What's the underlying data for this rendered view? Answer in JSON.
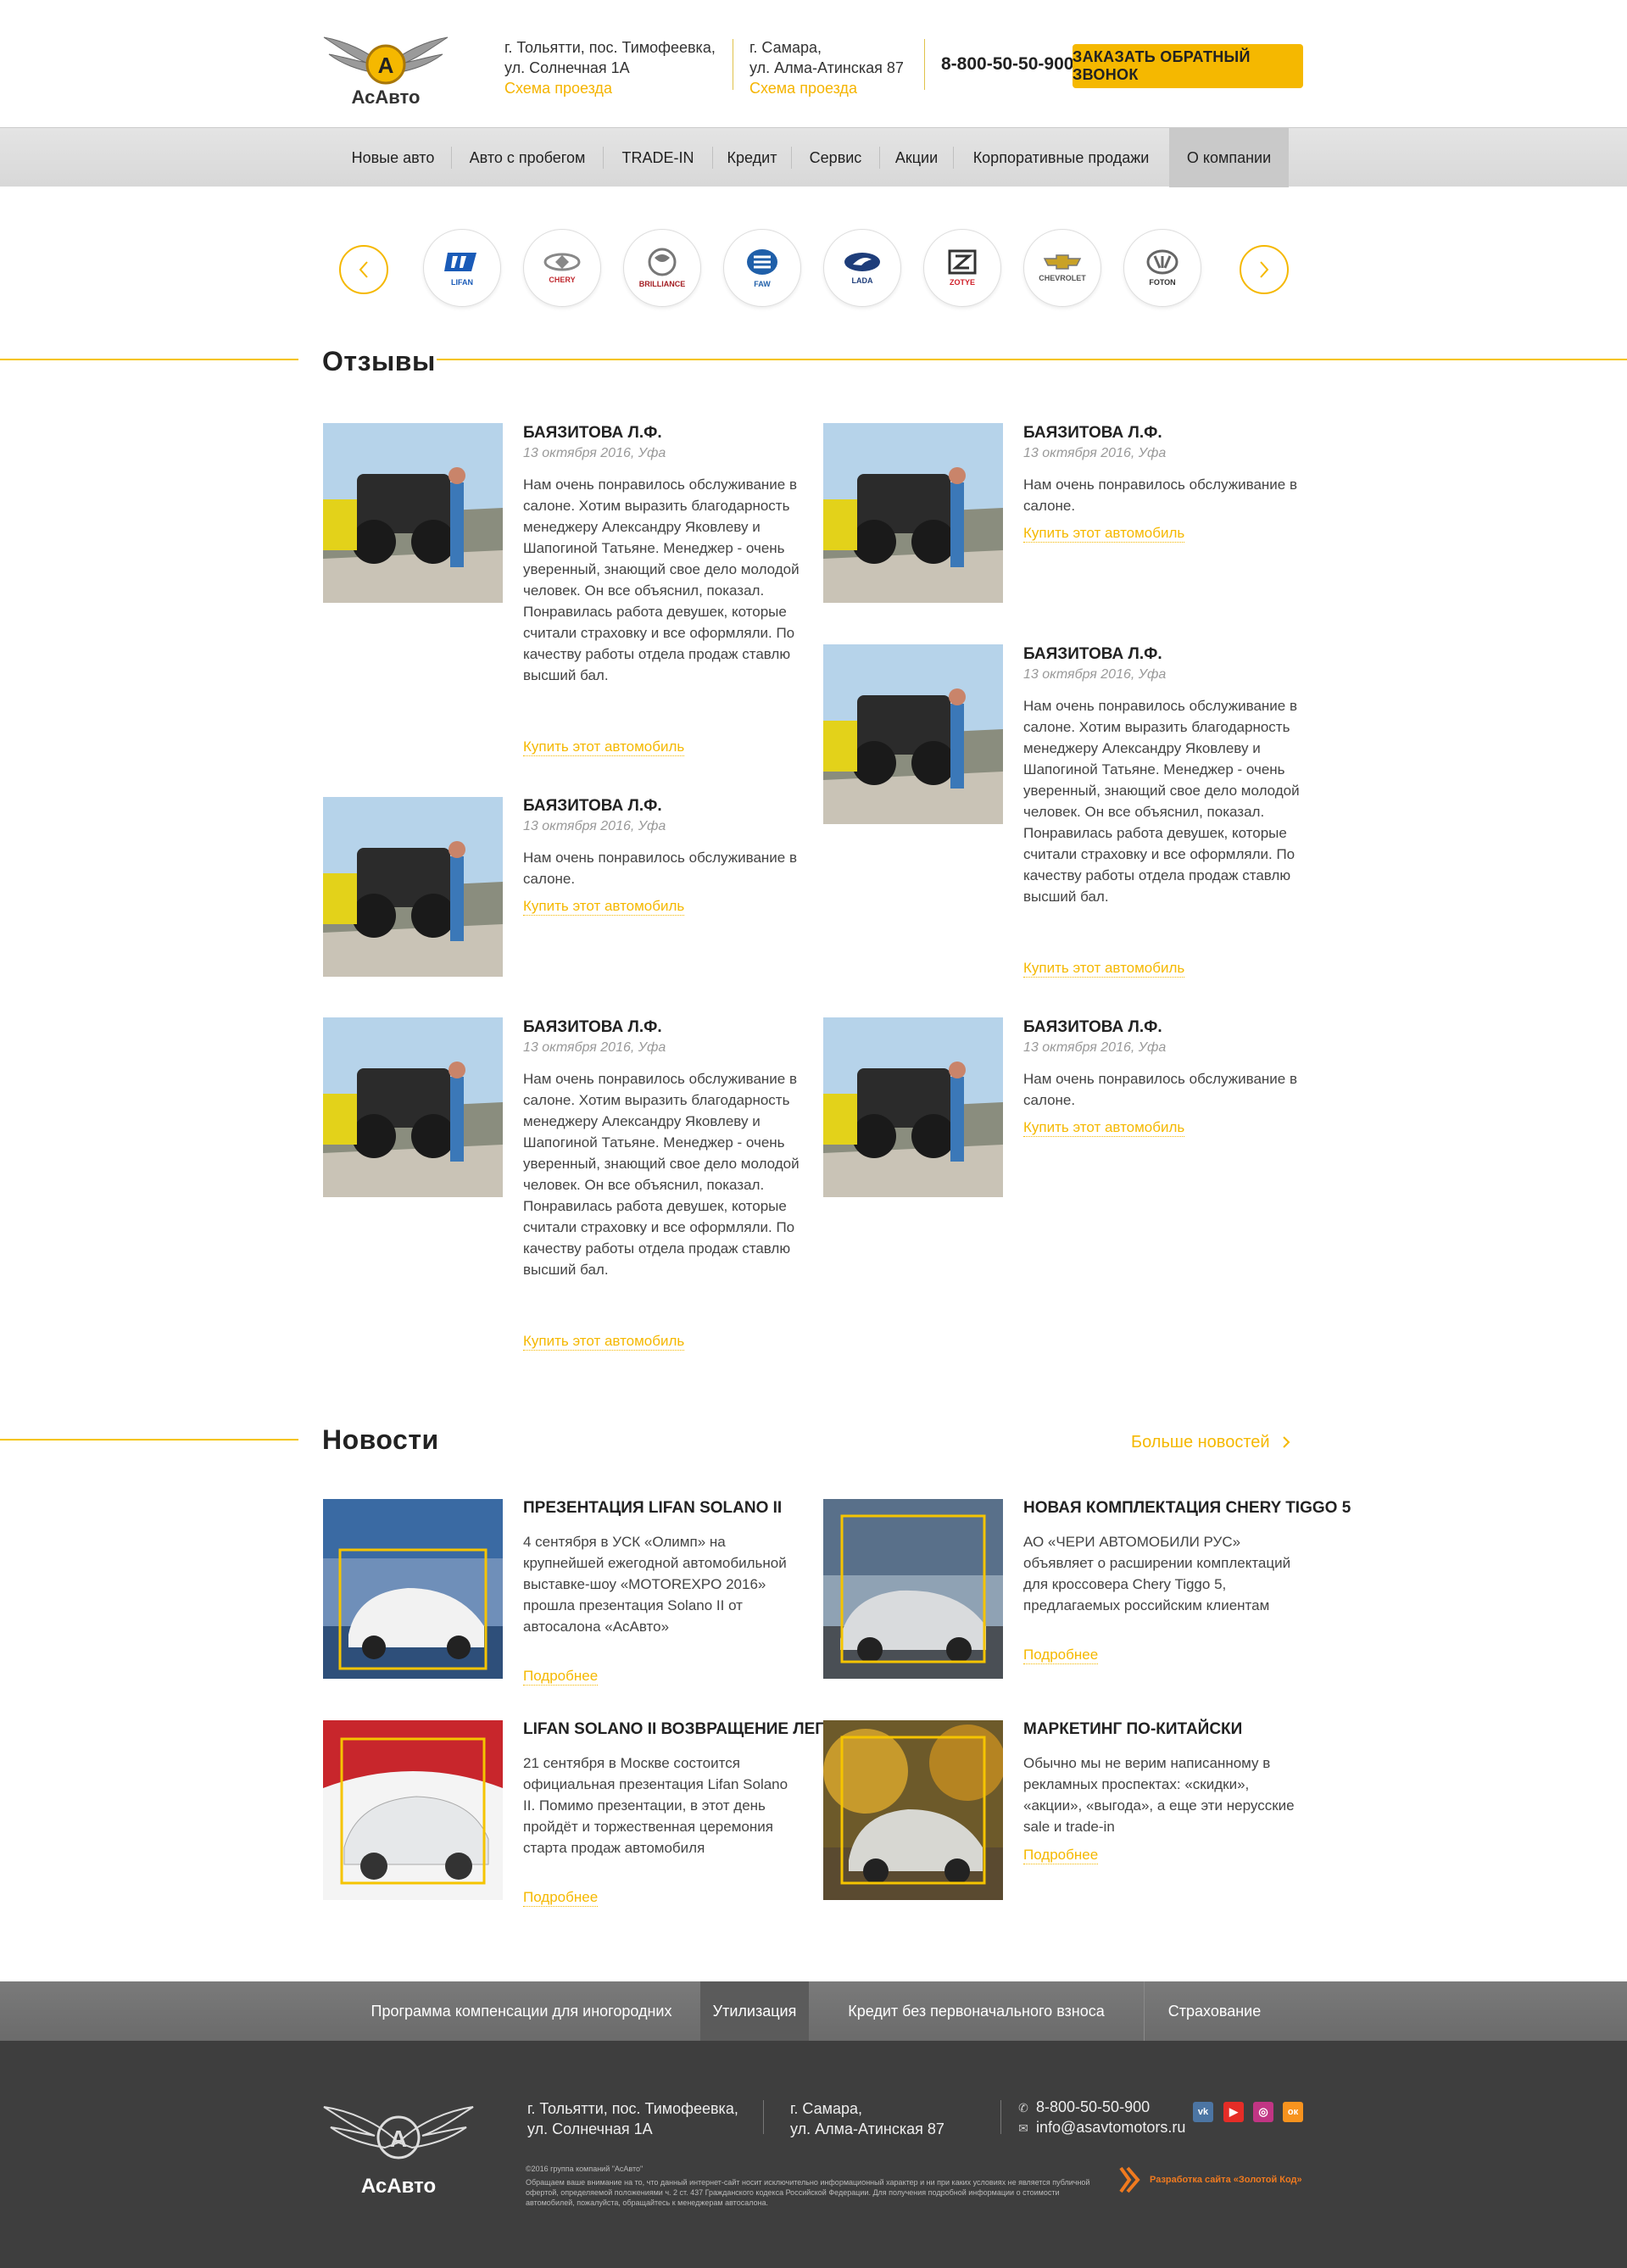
{
  "header": {
    "logo_text": "АсАвто",
    "address1": {
      "line1": "г. Тольятти, пос. Тимофеевка,",
      "line2": "ул. Солнечная 1А",
      "link": "Схема проезда"
    },
    "address2": {
      "line1": "г. Самара,",
      "line2": "ул. Алма-Атинская 87",
      "link": "Схема проезда"
    },
    "phone": "8-800-50-50-900",
    "callback_button": "Заказать обратный звонок"
  },
  "nav": {
    "items": [
      {
        "label": "Новые авто"
      },
      {
        "label": "Авто с пробегом"
      },
      {
        "label": "TRADE-IN"
      },
      {
        "label": "Кредит"
      },
      {
        "label": "Сервис"
      },
      {
        "label": "Акции"
      },
      {
        "label": "Корпоративные продажи"
      },
      {
        "label": "О компании"
      }
    ],
    "active": "О компании"
  },
  "brands": [
    {
      "name": "Lifan",
      "icon": "lifan-logo-icon",
      "color": "#1a5bb8"
    },
    {
      "name": "Chery",
      "icon": "chery-logo-icon",
      "color": "#c0292f"
    },
    {
      "name": "Brilliance",
      "icon": "brilliance-logo-icon",
      "color": "#a31d22"
    },
    {
      "name": "FAW",
      "icon": "faw-logo-icon",
      "color": "#1f5fa9"
    },
    {
      "name": "Lada",
      "icon": "lada-logo-icon",
      "color": "#1e3d7a"
    },
    {
      "name": "Zotye",
      "icon": "zotye-logo-icon",
      "color": "#d0202a"
    },
    {
      "name": "Chevrolet",
      "icon": "chevrolet-logo-icon",
      "color": "#c9a227"
    },
    {
      "name": "Foton",
      "icon": "foton-logo-icon",
      "color": "#555555"
    }
  ],
  "reviews": {
    "title": "Отзывы",
    "items": [
      {
        "name": "Баязитова Л.Ф.",
        "date": "13 октября 2016, Уфа",
        "text": "Нам очень понравилось обслуживание в салоне. Хотим выразить благодарность менеджеру Александру Яковлеву и Шапогиной Татьяне. Менеджер - очень уверенный, знающий свое дело молодой человек. Он все объяснил, показал. Понравилась работа девушек, которые считали страховку и все оформляли. По качеству работы отдела продаж ставлю высший бал.",
        "link": "Купить этот автомобиль"
      },
      {
        "name": "Баязитова Л.Ф.",
        "date": "13 октября 2016, Уфа",
        "text": "Нам очень понравилось обслуживание в салоне.",
        "link": "Купить этот автомобиль"
      },
      {
        "name": "Баязитова Л.Ф.",
        "date": "13 октября 2016, Уфа",
        "text": "Нам очень понравилось обслуживание в салоне. Хотим выразить благодарность менеджеру Александру Яковлеву и Шапогиной Татьяне. Менеджер - очень уверенный, знающий свое дело молодой человек. Он все объяснил, показал. Понравилась работа девушек, которые считали страховку и все оформляли. По качеству работы отдела продаж ставлю высший бал.",
        "link": "Купить этот автомобиль"
      },
      {
        "name": "Баязитова Л.Ф.",
        "date": "13 октября 2016, Уфа",
        "text": "Нам очень понравилось обслуживание в салоне.",
        "link": "Купить этот автомобиль"
      },
      {
        "name": "Баязитова Л.Ф.",
        "date": "13 октября 2016, Уфа",
        "text": "Нам очень понравилось обслуживание в салоне. Хотим выразить благодарность менеджеру Александру Яковлеву и Шапогиной Татьяне. Менеджер - очень уверенный, знающий свое дело молодой человек. Он все объяснил, показал. Понравилась работа девушек, которые считали страховку и все оформляли. По качеству работы отдела продаж ставлю высший бал.",
        "link": "Купить этот автомобиль"
      },
      {
        "name": "Баязитова Л.Ф.",
        "date": "13 октября 2016, Уфа",
        "text": "Нам очень понравилось обслуживание в салоне.",
        "link": "Купить этот автомобиль"
      }
    ]
  },
  "news": {
    "title": "Новости",
    "more_link": "Больше новостей",
    "items": [
      {
        "title": "Презентация Lifan Solano II",
        "text": "4 сентября в УСК «Олимп» на крупнейшей ежегодной автомобильной выставке-шоу «MOTOREXPO 2016» прошла презентация Solano II от автосалона «АсАвто»",
        "link": "Подробнее"
      },
      {
        "title": "Новая комплектация Chery Tiggo 5",
        "text": "АО «ЧЕРИ АВТОМОБИЛИ РУС» объявляет о расширении комплектаций для кроссовера Chery Tiggo 5, предлагаемых российским клиентам",
        "link": "Подробнее"
      },
      {
        "title": "Lifan Solano II возвращение легенды!",
        "text": "21 сентября в Москве состоится официальная презентация Lifan Solano II. Помимо презентации, в этот день пройдёт и торжественная церемония старта продаж автомобиля",
        "link": "Подробнее"
      },
      {
        "title": "Маркетинг по-китайски",
        "text": "Обычно мы не верим написанному в рекламных проспектах: «скидки», «акции», «выгода», а еще эти нерусские sale и trade-in",
        "link": "Подробнее"
      }
    ]
  },
  "bottom_nav": {
    "items": [
      {
        "label": "Программа компенсации для иногородних"
      },
      {
        "label": "Утилизация"
      },
      {
        "label": "Кредит без первоначального взноса"
      },
      {
        "label": "Страхование"
      }
    ],
    "active": "Утилизация"
  },
  "footer": {
    "logo_text": "АсАвто",
    "address1": {
      "line1": "г. Тольятти, пос. Тимофеевка,",
      "line2": "ул. Солнечная 1А"
    },
    "address2": {
      "line1": "г. Самара,",
      "line2": "ул. Алма-Атинская 87"
    },
    "phone": "8-800-50-50-900",
    "email": "info@asavtomotors.ru",
    "social": [
      {
        "name": "vk",
        "icon": "vk-icon",
        "color": "#4c75a3",
        "glyph": "vk"
      },
      {
        "name": "youtube",
        "icon": "youtube-icon",
        "color": "#e52d27",
        "glyph": "▶"
      },
      {
        "name": "instagram",
        "icon": "instagram-icon",
        "color": "#c13584",
        "glyph": "◎"
      },
      {
        "name": "odnoklassniki",
        "icon": "odnoklassniki-icon",
        "color": "#f7931e",
        "glyph": "ок"
      }
    ],
    "copyright": "©2016 группа компаний \"АсАвто\"",
    "disclaimer": "Обращаем ваше внимание на то, что данный интернет-сайт носит исключительно информационный характер и ни при каких условиях не является публичной офертой, определяемой положениями ч. 2 ст. 437 Гражданского кодекса Российской Федерации. Для получения подробной информации о стоимости автомобилей, пожалуйста, обращайтесь к менеджерам автосалона.",
    "developer": "Разработка сайта «Золотой Код»"
  },
  "colors": {
    "accent": "#f5b800",
    "nav_bg": "#dcdcdc",
    "footer_bg": "#3e3e3e",
    "bottom_nav_bg": "#6e6e6e"
  }
}
